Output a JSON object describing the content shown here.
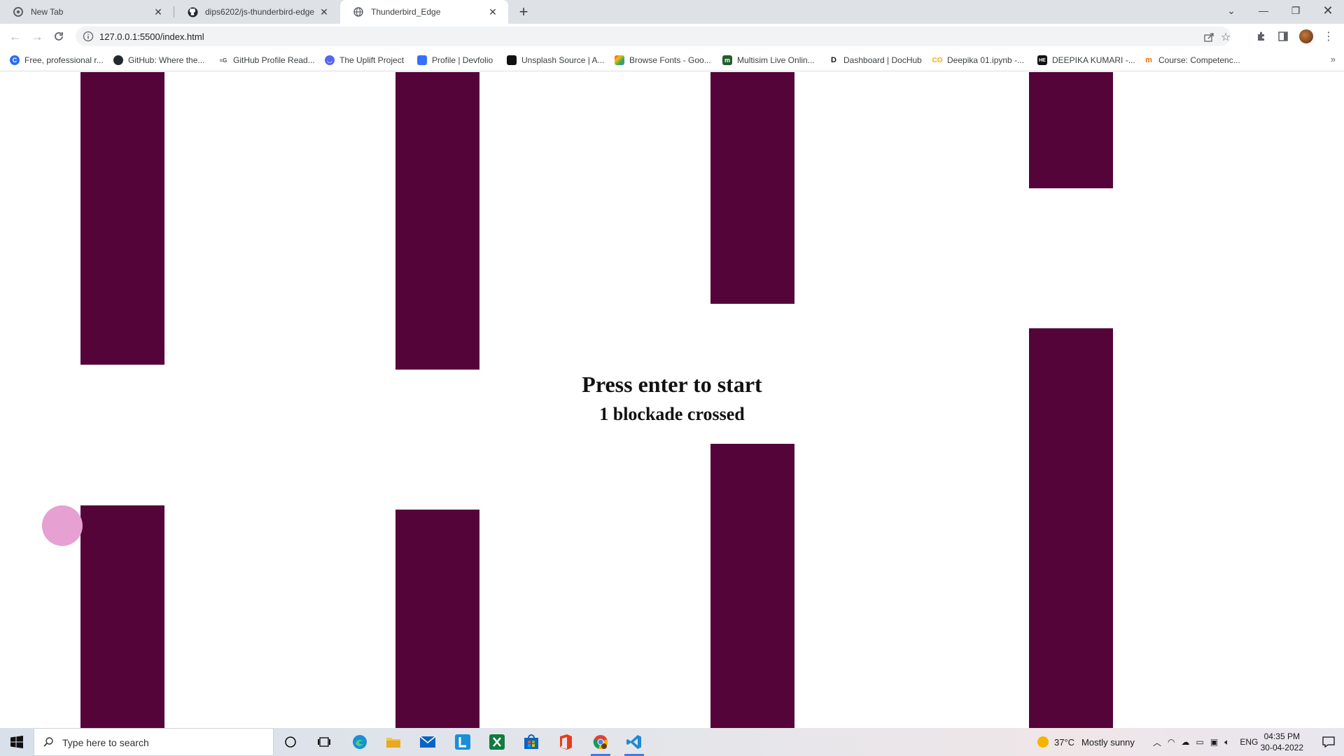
{
  "browser": {
    "tabs": [
      {
        "title": "New Tab",
        "icon": "chrome-icon",
        "active": false
      },
      {
        "title": "dips6202/js-thunderbird-edge",
        "icon": "github-icon",
        "active": false
      },
      {
        "title": "Thunderbird_Edge",
        "icon": "globe-icon",
        "active": true
      }
    ],
    "url": "127.0.0.1:5500/index.html",
    "bookmarks": [
      "Free, professional r...",
      "GitHub: Where the...",
      "GitHub Profile Read...",
      "The Uplift Project",
      "Profile | Devfolio",
      "Unsplash Source | A...",
      "Browse Fonts - Goo...",
      "Multisim Live Onlin...",
      "Dashboard | DocHub",
      "Deepika 01.ipynb -...",
      "DEEPIKA KUMARI -...",
      "Course: Competenc..."
    ]
  },
  "game": {
    "message": "Press enter to start",
    "score_text": "1 blockade crossed",
    "pipe_color": "#55043a",
    "bird_color": "#e6a0d2"
  },
  "taskbar": {
    "search_placeholder": "Type here to search",
    "weather_temp": "37°C",
    "weather_text": "Mostly sunny",
    "language": "ENG",
    "time": "04:35 PM",
    "date": "30-04-2022"
  }
}
